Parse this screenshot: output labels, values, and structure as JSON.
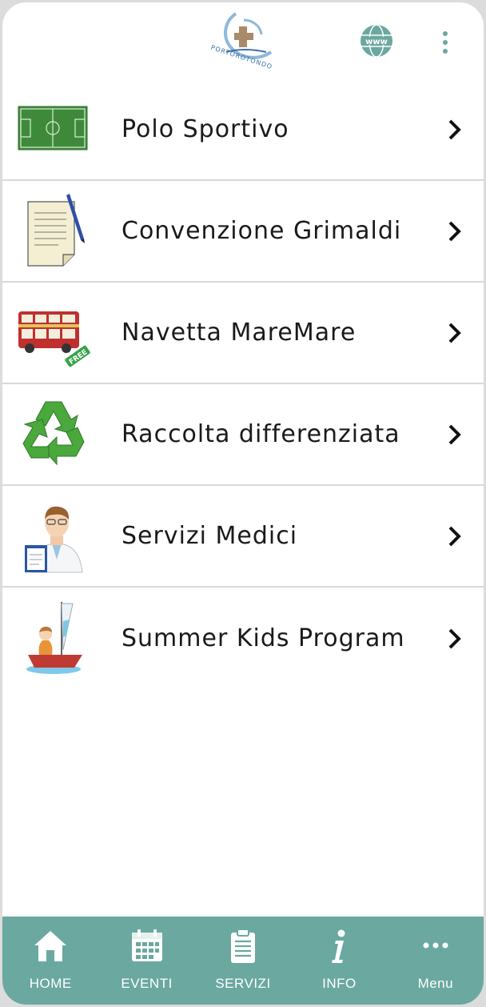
{
  "header": {
    "logo_text": "PORTOROTONDO",
    "globe_icon": "www-globe-icon",
    "menu_icon": "kebab-icon"
  },
  "list": {
    "items": [
      {
        "label": "Polo Sportivo",
        "icon": "football-field-icon"
      },
      {
        "label": "Convenzione Grimaldi",
        "icon": "document-pen-icon"
      },
      {
        "label": "Navetta MareMare",
        "icon": "bus-free-icon",
        "badge": "FREE"
      },
      {
        "label": "Raccolta differenziata",
        "icon": "recycle-icon"
      },
      {
        "label": "Servizi Medici",
        "icon": "doctor-icon"
      },
      {
        "label": "Summer Kids Program",
        "icon": "kid-sailboat-icon"
      }
    ]
  },
  "tabbar": {
    "tabs": [
      {
        "label": "HOME",
        "icon": "home-icon"
      },
      {
        "label": "EVENTI",
        "icon": "calendar-icon"
      },
      {
        "label": "SERVIZI",
        "icon": "clipboard-icon"
      },
      {
        "label": "INFO",
        "icon": "info-icon"
      },
      {
        "label": "Menu",
        "icon": "more-dots-icon"
      }
    ]
  },
  "colors": {
    "accent": "#6aa8a0",
    "divider": "#d9d9d9",
    "text": "#1a1a1a"
  }
}
